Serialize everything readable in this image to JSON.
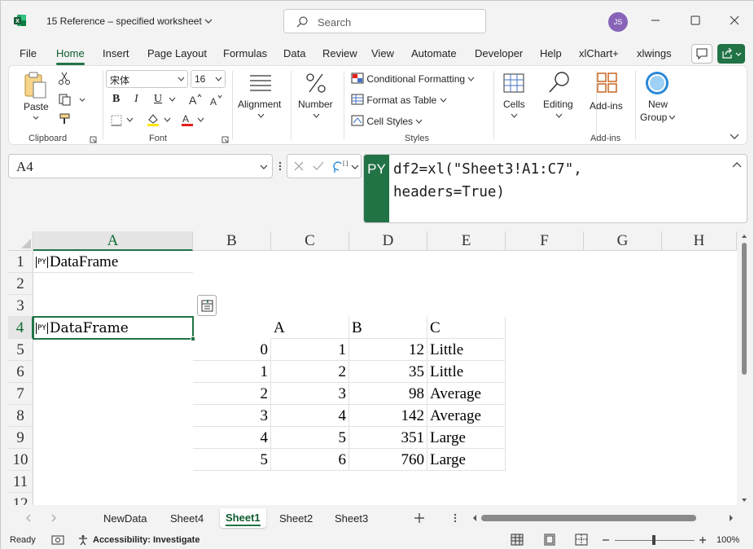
{
  "window": {
    "title": "15 Reference – specified worksheet",
    "search_placeholder": "Search",
    "user_initials": "JS"
  },
  "ribbon_tabs": [
    "File",
    "Home",
    "Insert",
    "Page Layout",
    "Formulas",
    "Data",
    "Review",
    "View",
    "Automate",
    "Developer",
    "Help",
    "xlChart+",
    "xlwings"
  ],
  "active_ribbon_tab": "Home",
  "ribbon": {
    "clipboard": {
      "paste_label": "Paste",
      "group_label": "Clipboard"
    },
    "font": {
      "font_name": "宋体",
      "font_size": "16",
      "group_label": "Font",
      "bold": "B",
      "italic": "I",
      "underline": "U"
    },
    "alignment_label": "Alignment",
    "number_label": "Number",
    "styles": {
      "conditional_formatting": "Conditional Formatting",
      "format_as_table": "Format as Table",
      "cell_styles": "Cell Styles",
      "group_label": "Styles"
    },
    "cells_label": "Cells",
    "editing_label": "Editing",
    "addins": {
      "button_label": "Add-ins",
      "group_label": "Add-ins"
    },
    "new_group": {
      "line1": "New",
      "line2": "Group"
    }
  },
  "formula_bar": {
    "name_box": "A4",
    "py_tag": "PY",
    "formula_line1": "df2=xl(\"Sheet3!A1:C7\",",
    "formula_line2": "headers=True)"
  },
  "grid": {
    "columns": [
      "A",
      "B",
      "C",
      "D",
      "E",
      "F",
      "G",
      "H"
    ],
    "rows": [
      "1",
      "2",
      "3",
      "4",
      "5",
      "6",
      "7",
      "8",
      "9",
      "10",
      "11",
      "12"
    ],
    "py_badge": "PY",
    "a1": "DataFrame",
    "a4": "DataFrame",
    "header_row": {
      "c": "A",
      "d": "B",
      "e": "C"
    },
    "data_rows": [
      {
        "b": "0",
        "c": "1",
        "d": "12",
        "e": "Little"
      },
      {
        "b": "1",
        "c": "2",
        "d": "35",
        "e": "Little"
      },
      {
        "b": "2",
        "c": "3",
        "d": "98",
        "e": "Average"
      },
      {
        "b": "3",
        "c": "4",
        "d": "142",
        "e": "Average"
      },
      {
        "b": "4",
        "c": "5",
        "d": "351",
        "e": "Large"
      },
      {
        "b": "5",
        "c": "6",
        "d": "760",
        "e": "Large"
      }
    ]
  },
  "sheets": [
    "NewData",
    "Sheet4",
    "Sheet1",
    "Sheet2",
    "Sheet3"
  ],
  "active_sheet": "Sheet1",
  "status": {
    "ready": "Ready",
    "accessibility": "Accessibility: Investigate",
    "zoom": "100%"
  },
  "colors": {
    "accent": "#217346",
    "avatar": "#8764b8"
  }
}
